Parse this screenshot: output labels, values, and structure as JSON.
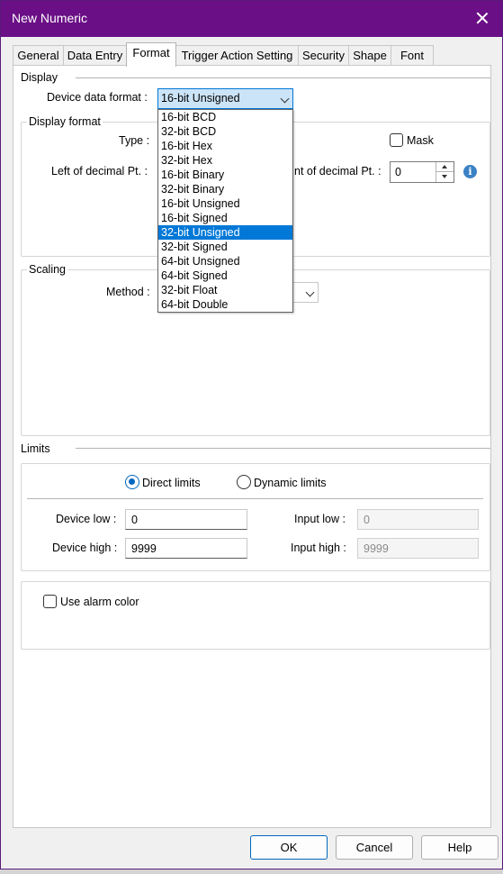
{
  "window": {
    "title": "New Numeric"
  },
  "tabs": [
    {
      "label": "General"
    },
    {
      "label": "Data Entry"
    },
    {
      "label": "Format"
    },
    {
      "label": "Trigger Action Setting"
    },
    {
      "label": "Security"
    },
    {
      "label": "Shape"
    },
    {
      "label": "Font"
    }
  ],
  "display": {
    "heading": "Display",
    "device_format_label": "Device data format :",
    "device_format_value": "16-bit Unsigned",
    "format_options": [
      "16-bit BCD",
      "32-bit BCD",
      "16-bit Hex",
      "32-bit Hex",
      "16-bit Binary",
      "32-bit Binary",
      "16-bit Unsigned",
      "16-bit Signed",
      "32-bit Unsigned",
      "32-bit Signed",
      "64-bit Unsigned",
      "64-bit Signed",
      "32-bit Float",
      "64-bit Double"
    ],
    "highlighted_option": "32-bit Unsigned"
  },
  "display_format": {
    "group_title": "Display format",
    "type_label": "Type :",
    "mask_label": "Mask",
    "left_label": "Left of decimal Pt. :",
    "right_label_visible": "nt of decimal Pt. :",
    "right_value": "0"
  },
  "scaling": {
    "group_title": "Scaling",
    "method_label": "Method :"
  },
  "limits": {
    "heading": "Limits",
    "direct_label": "Direct limits",
    "dynamic_label": "Dynamic limits",
    "selected": "Direct limits",
    "device_low_label": "Device low :",
    "device_low_value": "0",
    "device_high_label": "Device high :",
    "device_high_value": "9999",
    "input_low_label": "Input low :",
    "input_low_value": "0",
    "input_high_label": "Input high :",
    "input_high_value": "9999"
  },
  "alarm": {
    "label": "Use alarm color",
    "checked": false
  },
  "buttons": {
    "ok": "OK",
    "cancel": "Cancel",
    "help": "Help"
  },
  "colors": {
    "titlebar": "#6a0f86",
    "accent": "#0078d7"
  }
}
